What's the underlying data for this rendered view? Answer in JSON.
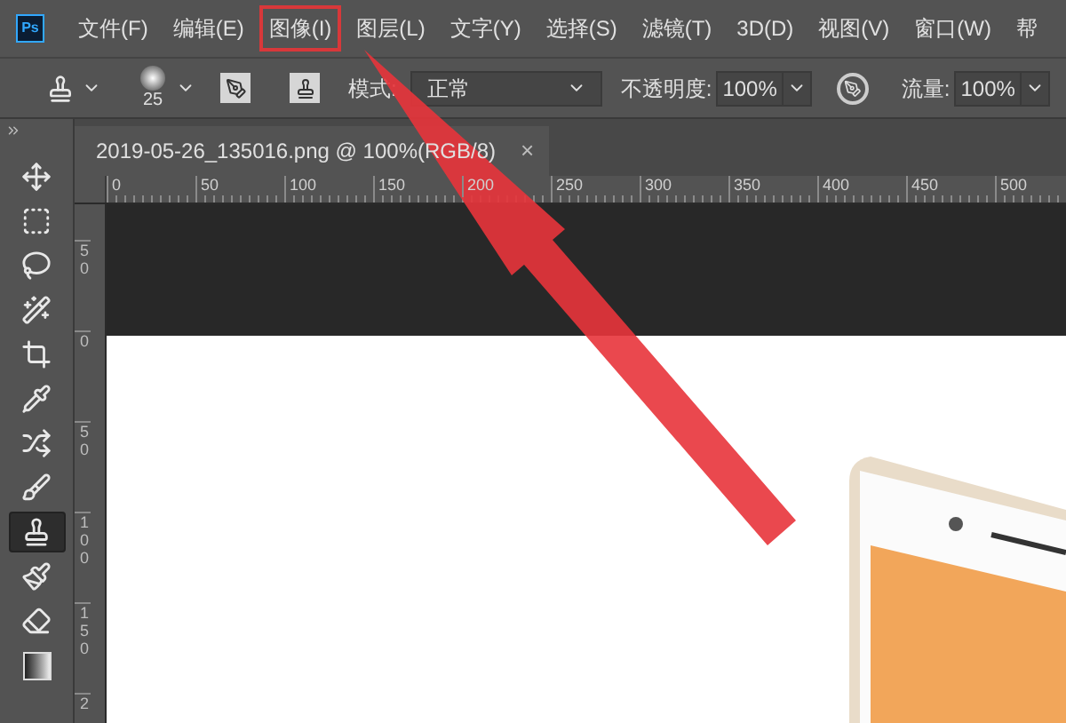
{
  "app": {
    "logo": "Ps"
  },
  "menu": [
    {
      "label": "文件(F)",
      "marked": false
    },
    {
      "label": "编辑(E)",
      "marked": false
    },
    {
      "label": "图像(I)",
      "marked": true
    },
    {
      "label": "图层(L)",
      "marked": false
    },
    {
      "label": "文字(Y)",
      "marked": false
    },
    {
      "label": "选择(S)",
      "marked": false
    },
    {
      "label": "滤镜(T)",
      "marked": false
    },
    {
      "label": "3D(D)",
      "marked": false
    },
    {
      "label": "视图(V)",
      "marked": false
    },
    {
      "label": "窗口(W)",
      "marked": false
    },
    {
      "label": "帮",
      "marked": false
    }
  ],
  "options_bar": {
    "brush_size": "25",
    "mode_label": "模式:",
    "mode_value": "正常",
    "opacity_label": "不透明度:",
    "opacity_value": "100%",
    "flow_label": "流量:",
    "flow_value": "100%"
  },
  "tools": [
    {
      "kind": "move",
      "selected": false
    },
    {
      "kind": "marquee",
      "selected": false
    },
    {
      "kind": "lasso",
      "selected": false
    },
    {
      "kind": "quick-select",
      "selected": false
    },
    {
      "kind": "crop",
      "selected": false
    },
    {
      "kind": "eyedropper",
      "selected": false
    },
    {
      "kind": "healing",
      "selected": false
    },
    {
      "kind": "brush",
      "selected": false
    },
    {
      "kind": "stamp",
      "selected": true
    },
    {
      "kind": "history-brush",
      "selected": false
    },
    {
      "kind": "eraser",
      "selected": false
    },
    {
      "kind": "gradient",
      "selected": false
    }
  ],
  "document_tab": {
    "title": "2019-05-26_135016.png @ 100%(RGB/8)",
    "close": "×"
  },
  "horizontal_ruler": [
    "0",
    "50",
    "100",
    "150",
    "200",
    "250",
    "300",
    "350",
    "400",
    "450",
    "500"
  ],
  "vertical_ruler": [
    "50",
    "0",
    "50",
    "100",
    "150",
    "2"
  ]
}
